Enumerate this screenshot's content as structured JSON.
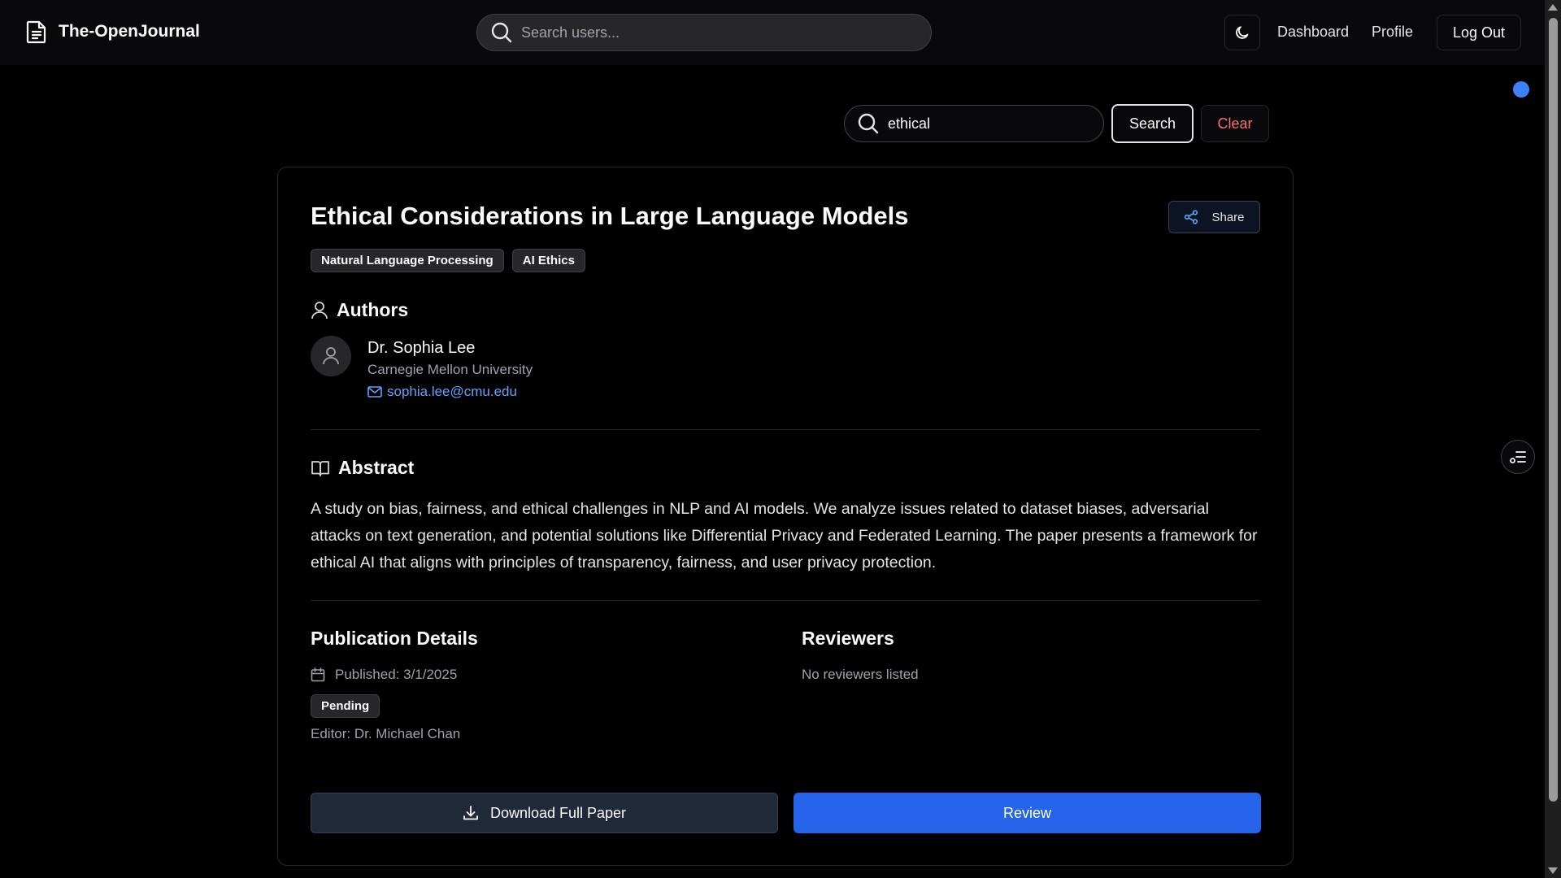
{
  "app": {
    "title": "The-OpenJournal"
  },
  "nav": {
    "search_placeholder": "Search users...",
    "links": {
      "dashboard": "Dashboard",
      "profile": "Profile"
    },
    "logout_label": "Log Out",
    "theme_icon": "moon-icon"
  },
  "paper_search": {
    "value": "ethical",
    "search_label": "Search",
    "clear_label": "Clear"
  },
  "paper": {
    "title": "Ethical Considerations in Large Language Models",
    "share_label": "Share",
    "tags": [
      "Natural Language Processing",
      "AI Ethics"
    ],
    "authors_heading": "Authors",
    "author": {
      "name": "Dr. Sophia Lee",
      "affiliation": "Carnegie Mellon University",
      "email": "sophia.lee@cmu.edu"
    },
    "abstract_heading": "Abstract",
    "abstract": "A study on bias, fairness, and ethical challenges in NLP and AI models. We analyze issues related to dataset biases, adversarial attacks on text generation, and potential solutions like Differential Privacy and Federated Learning. The paper presents a framework for ethical AI that aligns with principles of transparency, fairness, and user privacy protection.",
    "publication": {
      "heading": "Publication Details",
      "published": "Published: 3/1/2025",
      "status": "Pending",
      "editor": "Editor: Dr. Michael Chan"
    },
    "reviewers": {
      "heading": "Reviewers",
      "empty_text": "No reviewers listed"
    },
    "download_label": "Download Full Paper",
    "review_label": "Review"
  },
  "colors": {
    "background": "#000000",
    "accent": "#2563eb",
    "link": "#60a5fa",
    "danger": "#f87171",
    "indicator": "#3b82f6"
  }
}
